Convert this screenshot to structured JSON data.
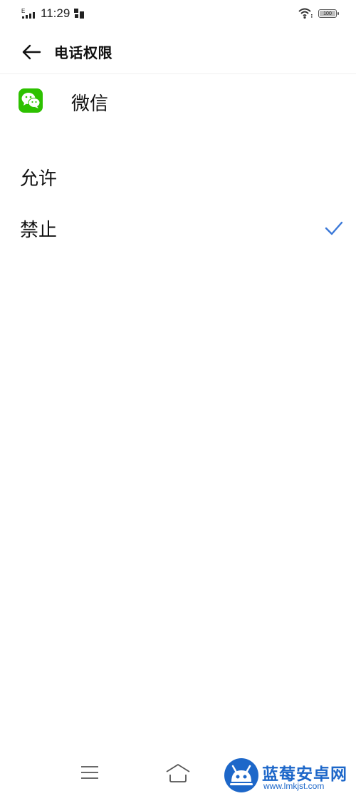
{
  "status_bar": {
    "network": "E",
    "time": "11:29",
    "battery": "100"
  },
  "header": {
    "title": "电话权限"
  },
  "app": {
    "name": "微信"
  },
  "options": [
    {
      "label": "允许",
      "selected": false
    },
    {
      "label": "禁止",
      "selected": true
    }
  ],
  "icons": {
    "back": "arrow-left-icon",
    "app": "wechat-icon",
    "check": "checkmark-icon",
    "nav_menu": "menu-icon",
    "nav_home": "home-icon"
  },
  "colors": {
    "accent": "#3a78d8",
    "wechat_green": "#2dc100",
    "watermark_blue": "#1d67c9"
  },
  "watermark": {
    "title": "蓝莓安卓网",
    "url": "www.lmkjst.com"
  }
}
